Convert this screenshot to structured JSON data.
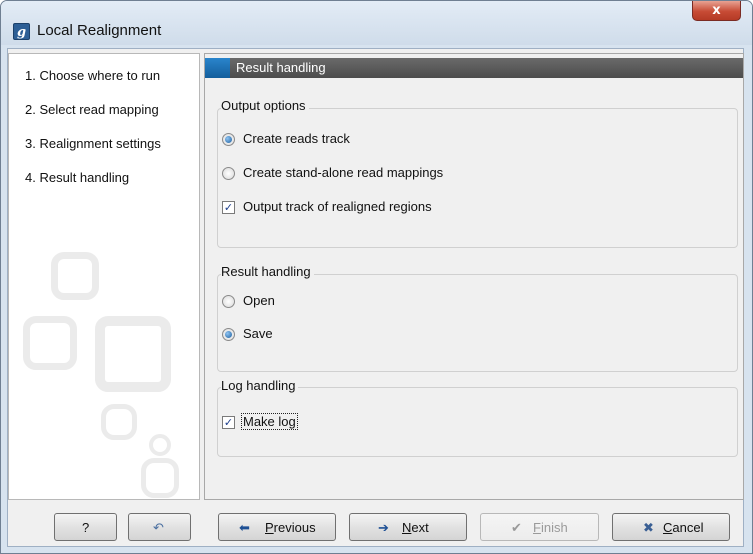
{
  "window": {
    "title": "Local Realignment",
    "app_icon_glyph": "g",
    "close_glyph": "x"
  },
  "steps": [
    "1.  Choose where to run",
    "2.  Select read mapping",
    "3.  Realignment settings",
    "4.  Result handling"
  ],
  "section_header": "Result handling",
  "output_options": {
    "title": "Output options",
    "create_reads_track": "Create reads track",
    "create_standalone": "Create stand-alone read mappings",
    "output_track_realigned": "Output track of realigned regions"
  },
  "result_handling": {
    "title": "Result handling",
    "open": "Open",
    "save": "Save"
  },
  "log_handling": {
    "title": "Log handling",
    "make_log": "Make log"
  },
  "buttons": {
    "help": "?",
    "reset_icon": "↶",
    "previous": {
      "icon": "⬅",
      "mnemonic": "P",
      "rest": "revious"
    },
    "next": {
      "icon": "➔",
      "mnemonic": "N",
      "rest": "ext"
    },
    "finish": {
      "icon": "✔",
      "mnemonic": "F",
      "rest": "inish"
    },
    "cancel": {
      "icon": "✖",
      "mnemonic": "C",
      "rest": "ancel"
    }
  },
  "colors": {
    "header_accent": "#1e6fb3",
    "close_button": "#c74b35"
  }
}
